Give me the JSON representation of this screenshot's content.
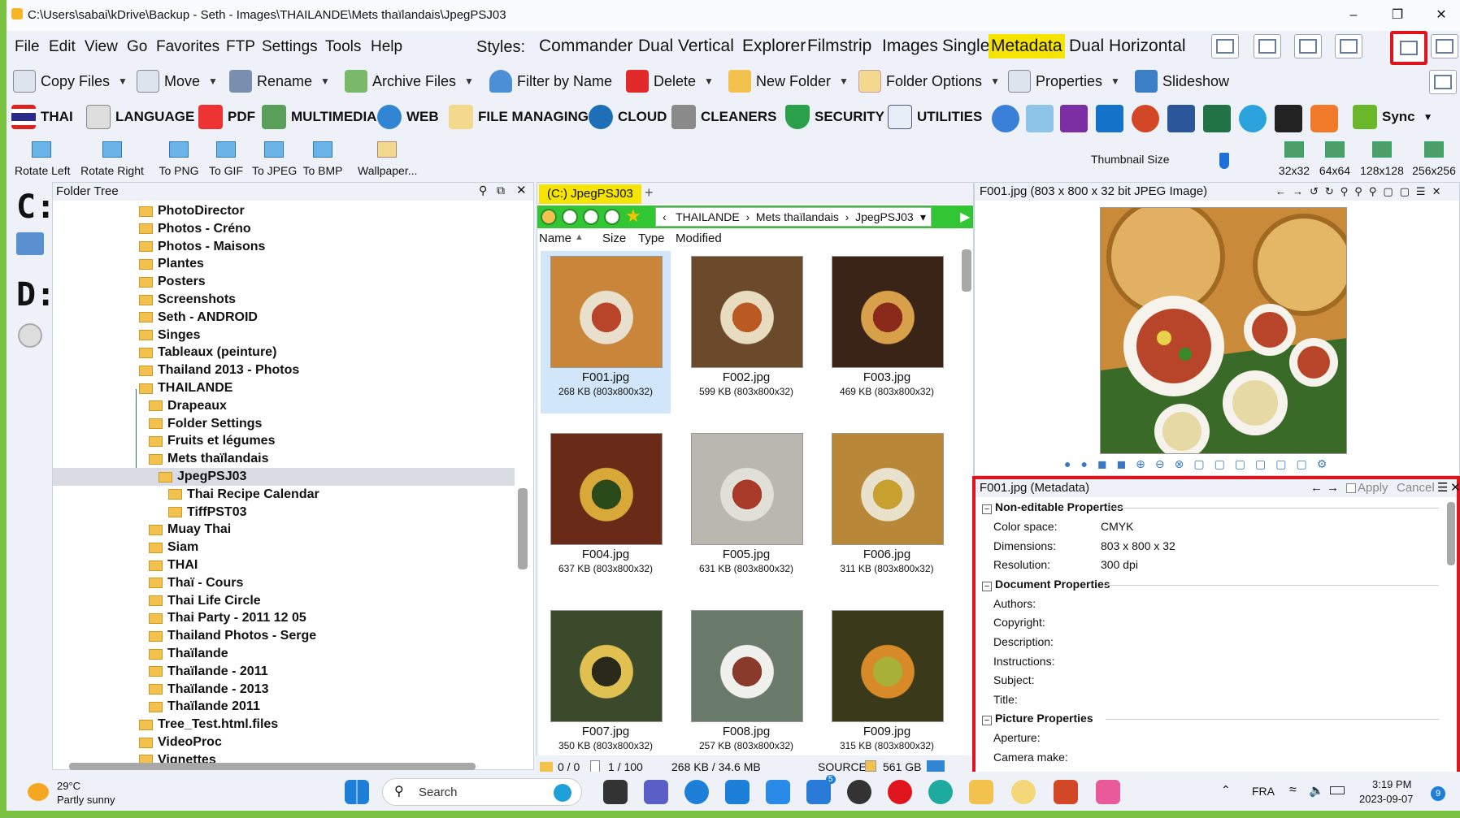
{
  "window": {
    "title": "C:\\Users\\sabai\\kDrive\\Backup - Seth - Images\\THAILANDE\\Mets thaïlandais\\JpegPSJ03"
  },
  "menu": [
    "File",
    "Edit",
    "View",
    "Go",
    "Favorites",
    "FTP",
    "Settings",
    "Tools",
    "Help"
  ],
  "styles": {
    "label": "Styles:",
    "items": [
      "Commander",
      "Dual Vertical",
      "Explorer",
      "Filmstrip",
      "Images",
      "Single",
      "Metadata",
      "Dual Horizontal"
    ],
    "active": "Metadata"
  },
  "toolbar": {
    "buttons": [
      "Copy Files",
      "Move",
      "Rename",
      "Archive Files",
      "Filter by Name",
      "Delete",
      "New Folder",
      "Folder Options",
      "Properties",
      "Slideshow"
    ]
  },
  "categories": [
    "THAI",
    "LANGUAGE",
    "PDF",
    "MULTIMEDIA",
    "WEB",
    "FILE MANAGING",
    "CLOUD",
    "CLEANERS",
    "SECURITY",
    "UTILITIES"
  ],
  "sync_label": "Sync",
  "image_tools": [
    "Rotate Left",
    "Rotate Right",
    "To PNG",
    "To GIF",
    "To JPEG",
    "To BMP",
    "Wallpaper..."
  ],
  "thumbnail": {
    "label": "Thumbnail Size",
    "sizes": [
      "32x32",
      "64x64",
      "128x128",
      "256x256"
    ]
  },
  "drives": [
    "C:",
    "D:"
  ],
  "folder_tree": {
    "title": "Folder Tree",
    "items": [
      "PhotoDirector",
      "Photos - Créno",
      "Photos - Maisons",
      "Plantes",
      "Posters",
      "Screenshots",
      "Seth - ANDROID",
      "Singes",
      "Tableaux (peinture)",
      "Thailand 2013 - Photos",
      "THAILANDE",
      "Drapeaux",
      "Folder Settings",
      "Fruits et légumes",
      "Mets thaïlandais",
      "JpegPSJ03",
      "Thai Recipe Calendar",
      "TiffPST03",
      "Muay Thai",
      "Siam",
      "THAI",
      "Thaï - Cours",
      "Thai Life Circle",
      "Thai Party - 2011 12 05",
      "Thailand Photos - Serge",
      "Thaïlande",
      "Thaïlande - 2011",
      "Thaïlande - 2013",
      "Thaïlande 2011",
      "Tree_Test.html.files",
      "VideoProc",
      "Vignettes"
    ],
    "selected": "JpegPSJ03"
  },
  "file_pane": {
    "tab": "(C:) JpegPSJ03",
    "breadcrumb": [
      "THAILANDE",
      "Mets thaïlandais",
      "JpegPSJ03"
    ],
    "columns": [
      "Name",
      "Size",
      "Type",
      "Modified"
    ],
    "files": [
      {
        "name": "F001.jpg",
        "info": "268 KB (803x800x32)"
      },
      {
        "name": "F002.jpg",
        "info": "599 KB (803x800x32)"
      },
      {
        "name": "F003.jpg",
        "info": "469 KB (803x800x32)"
      },
      {
        "name": "F004.jpg",
        "info": "637 KB (803x800x32)"
      },
      {
        "name": "F005.jpg",
        "info": "631 KB (803x800x32)"
      },
      {
        "name": "F006.jpg",
        "info": "311 KB (803x800x32)"
      },
      {
        "name": "F007.jpg",
        "info": "350 KB (803x800x32)"
      },
      {
        "name": "F008.jpg",
        "info": "257 KB (803x800x32)"
      },
      {
        "name": "F009.jpg",
        "info": "315 KB (803x800x32)"
      }
    ]
  },
  "status": {
    "folders": "0 / 0",
    "files": "1 / 100",
    "size": "268 KB / 34.6 MB",
    "source": "SOURCE",
    "free": "561 GB"
  },
  "preview": {
    "title": "F001.jpg (803 x 800 x 32 bit JPEG Image)"
  },
  "metadata": {
    "title": "F001.jpg (Metadata)",
    "apply": "Apply",
    "cancel": "Cancel",
    "sections": [
      {
        "name": "Non-editable Properties",
        "rows": [
          {
            "key": "Color space:",
            "value": "CMYK"
          },
          {
            "key": "Dimensions:",
            "value": "803 x 800 x 32"
          },
          {
            "key": "Resolution:",
            "value": "300 dpi"
          }
        ]
      },
      {
        "name": "Document Properties",
        "rows": [
          {
            "key": "Authors:",
            "value": ""
          },
          {
            "key": "Copyright:",
            "value": ""
          },
          {
            "key": "Description:",
            "value": ""
          },
          {
            "key": "Instructions:",
            "value": ""
          },
          {
            "key": "Subject:",
            "value": ""
          },
          {
            "key": "Title:",
            "value": ""
          }
        ]
      },
      {
        "name": "Picture Properties",
        "rows": [
          {
            "key": "Aperture:",
            "value": ""
          },
          {
            "key": "Camera make:",
            "value": ""
          }
        ]
      }
    ]
  },
  "taskbar": {
    "weather_temp": "29°C",
    "weather_desc": "Partly sunny",
    "search": "Search",
    "lang": "FRA",
    "time": "3:19 PM",
    "date": "2023-09-07",
    "badge": "5",
    "notif": "9"
  },
  "colors": {
    "highlight": "#f5e400",
    "address_bar": "#32c634",
    "metadata_border": "#e0141c",
    "border_green": "#7cc242"
  }
}
